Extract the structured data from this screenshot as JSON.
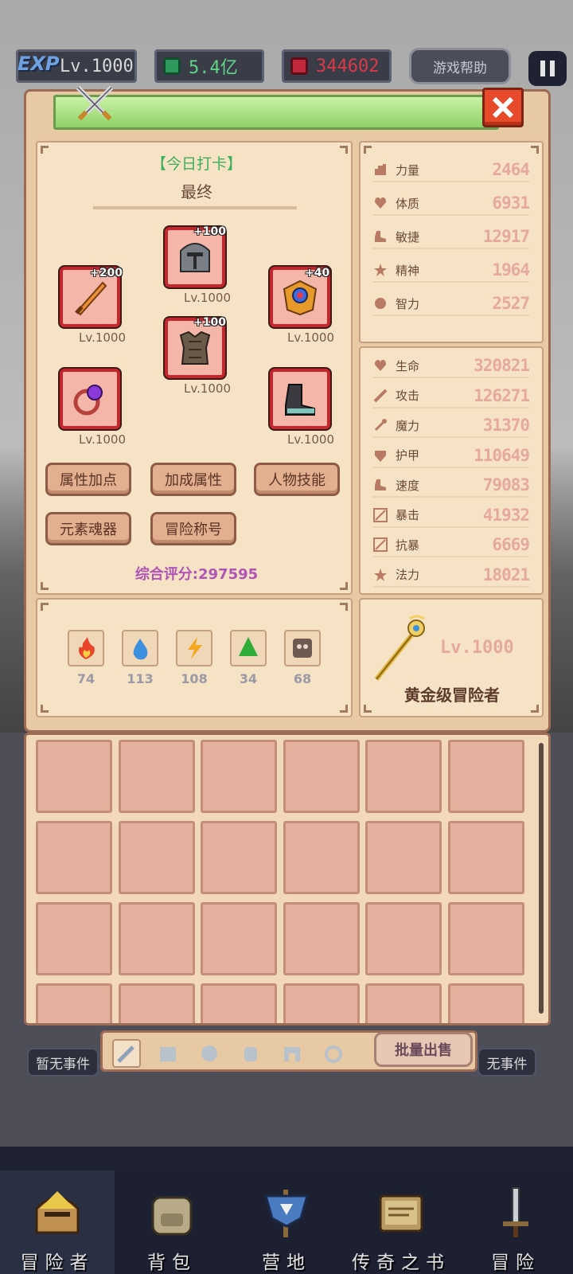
{
  "hud": {
    "exp_tag": "EXP",
    "level": "Lv.1000",
    "green_currency": "5.4亿",
    "red_currency": "344602",
    "help_label": "游戏帮助"
  },
  "character": {
    "daily_checkin": "【今日打卡】",
    "title": "最终",
    "score_label": "综合评分:297595"
  },
  "equipment": [
    {
      "name": "weapon",
      "plus": "+200",
      "level": "Lv.1000"
    },
    {
      "name": "helmet",
      "plus": "+100",
      "level": "Lv.1000"
    },
    {
      "name": "amulet",
      "plus": "+40",
      "level": "Lv.1000"
    },
    {
      "name": "armor",
      "plus": "+100",
      "level": "Lv.1000"
    },
    {
      "name": "ring",
      "plus": "",
      "level": "Lv.1000"
    },
    {
      "name": "boots",
      "plus": "",
      "level": "Lv.1000"
    }
  ],
  "buttons": {
    "attr_points": "属性加点",
    "bonus_attr": "加成属性",
    "char_skills": "人物技能",
    "element_soul": "元素魂器",
    "adv_title": "冒险称号"
  },
  "base_stats": [
    {
      "label": "力量",
      "value": "2464",
      "icon": "fist-icon"
    },
    {
      "label": "体质",
      "value": "6931",
      "icon": "heart-icon"
    },
    {
      "label": "敏捷",
      "value": "12917",
      "icon": "boot-icon"
    },
    {
      "label": "精神",
      "value": "1964",
      "icon": "star-icon"
    },
    {
      "label": "智力",
      "value": "2527",
      "icon": "brain-icon"
    }
  ],
  "combat_stats": [
    {
      "label": "生命",
      "value": "320821",
      "icon": "heart-icon"
    },
    {
      "label": "攻击",
      "value": "126271",
      "icon": "sword-icon"
    },
    {
      "label": "魔力",
      "value": "31370",
      "icon": "wand-icon"
    },
    {
      "label": "护甲",
      "value": "110649",
      "icon": "shield-icon"
    },
    {
      "label": "速度",
      "value": "79083",
      "icon": "boot-icon"
    },
    {
      "label": "暴击",
      "value": "41932",
      "icon": "crit-icon"
    },
    {
      "label": "抗暴",
      "value": "6669",
      "icon": "crit-icon"
    },
    {
      "label": "法力",
      "value": "18021",
      "icon": "star-icon"
    }
  ],
  "elements": [
    {
      "name": "fire",
      "value": "74",
      "color": "#e8452a"
    },
    {
      "name": "water",
      "value": "113",
      "color": "#3d8fe0"
    },
    {
      "name": "lightning",
      "value": "108",
      "color": "#f2a81f"
    },
    {
      "name": "earth",
      "value": "34",
      "color": "#2fae3a"
    },
    {
      "name": "dark",
      "value": "68",
      "color": "#6e5a50"
    }
  ],
  "rank": {
    "level": "Lv.1000",
    "name": "黄金级冒险者"
  },
  "inventory": {
    "batch_sell": "批量出售",
    "tabs": [
      "sword-icon",
      "armor-icon",
      "helmet-icon",
      "robot-icon",
      "gate-icon",
      "ring-icon"
    ]
  },
  "events": {
    "left": "暂无事件",
    "right": "无事件"
  },
  "nav": [
    {
      "label": "冒险者",
      "icon": "knight-helmet-icon"
    },
    {
      "label": "背包",
      "icon": "backpack-icon"
    },
    {
      "label": "营地",
      "icon": "banner-icon"
    },
    {
      "label": "传奇之书",
      "icon": "book-icon"
    },
    {
      "label": "冒险",
      "icon": "sword-icon"
    }
  ]
}
